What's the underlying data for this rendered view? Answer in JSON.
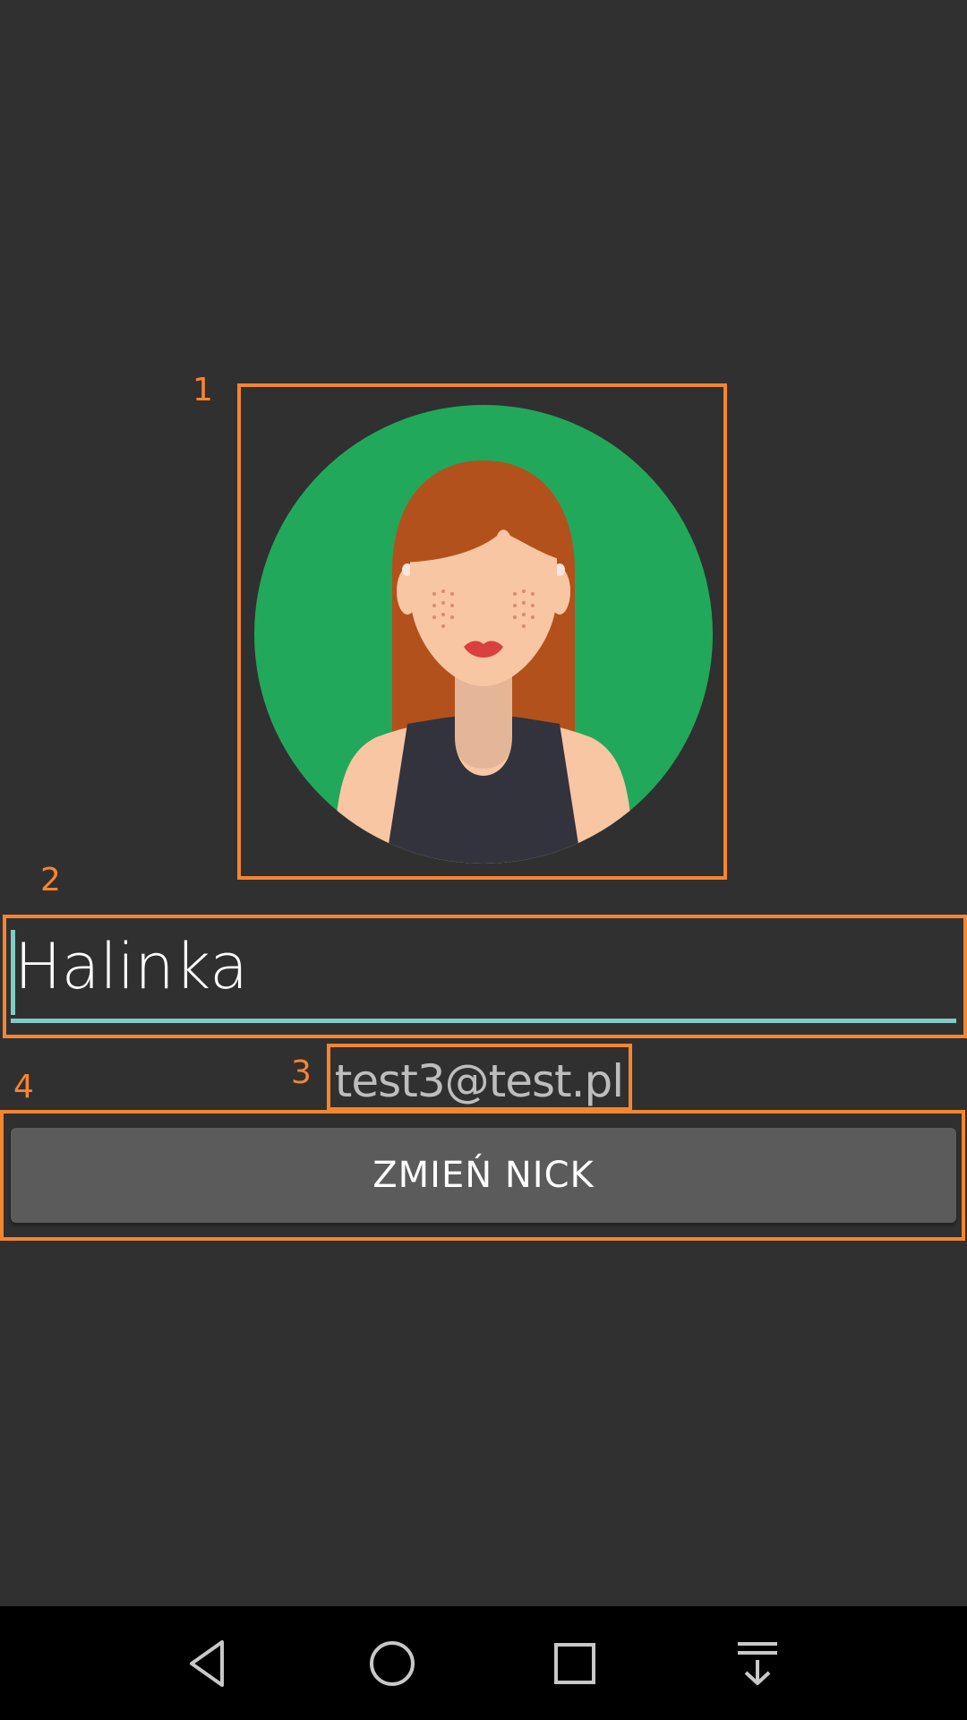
{
  "profile": {
    "nickname": "Halinka",
    "email": "test3@test.pl",
    "change_nick_label": "ZMIEŃ NICK"
  },
  "annotations": {
    "labels": [
      "1",
      "2",
      "3",
      "4"
    ],
    "color": "#f6852f"
  },
  "avatar": {
    "icon": "woman-avatar-icon",
    "background_color": "#22a85a",
    "hair_color": "#b2511c",
    "skin_color": "#f8c6a2"
  },
  "navigation_bar": {
    "buttons": [
      "back-icon",
      "home-icon",
      "recents-icon",
      "notifications-pull-icon"
    ]
  },
  "colors": {
    "background": "#303030",
    "accent": "#80cbc4",
    "button": "#5b5b5c",
    "navbar": "#000000"
  }
}
